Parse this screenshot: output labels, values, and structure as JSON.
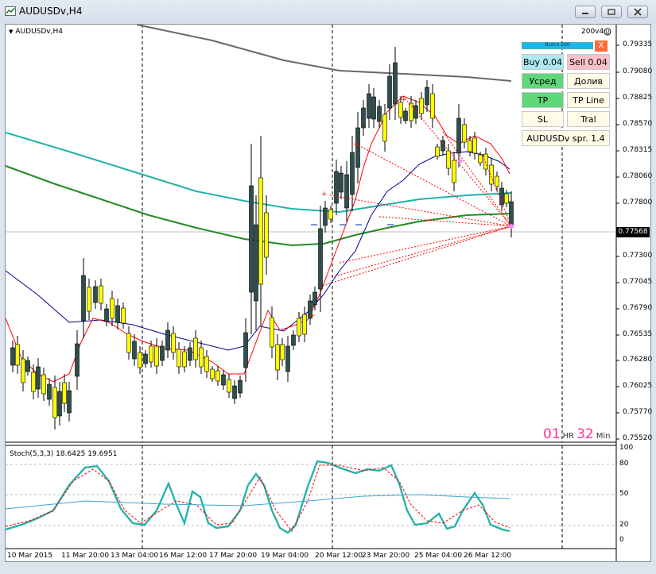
{
  "window": {
    "title": "AUDUSDv,H4"
  },
  "chart": {
    "symbol_label": "AUDUSDv,H4",
    "stoch_label": "Stoch(5,3,3) 18.6425 19.6951",
    "top_right_label": "200v4",
    "current_price": "0.77568",
    "price_ticks": [
      "0.79335",
      "0.79080",
      "0.78825",
      "0.78570",
      "0.78315",
      "0.78060",
      "0.77800",
      "0.77300",
      "0.77045",
      "0.76790",
      "0.76535",
      "0.76280",
      "0.76025",
      "0.75770",
      "0.75520"
    ],
    "stoch_ticks": [
      "100",
      "80",
      "50",
      "20",
      "0"
    ],
    "time_labels": [
      "10 Mar 2015",
      "11 Mar 20:00",
      "13 Mar 04:00",
      "16 Mar 12:00",
      "17 Mar 20:00",
      "19 Mar 04:00",
      "20 Mar 12:00",
      "23 Mar 20:00",
      "25 Mar 04:00",
      "26 Mar 12:00"
    ]
  },
  "panel": {
    "progress_label": "Всего 200",
    "close": "X",
    "buy": "Buy 0.04",
    "sell": "Sell 0.04",
    "average": "Усред",
    "refill": "Долив",
    "tp": "TP",
    "tp_line": "TP Line",
    "sl": "SL",
    "trail": "Tral",
    "spread": "AUDUSDv  spr. 1.4"
  },
  "timer": {
    "hours": "01",
    "hr_unit": "HR",
    "minutes": "32",
    "min_unit": "Min"
  },
  "colors": {
    "bull": "#ffff00",
    "bear": "#2f4f4f",
    "ma_fast": "#ff0000",
    "ma_slow": "#00008b",
    "ma_cyan": "#20b2aa",
    "ma_green": "#228b22",
    "ma_gray": "#696969",
    "timer": "#ff2fa0"
  }
}
